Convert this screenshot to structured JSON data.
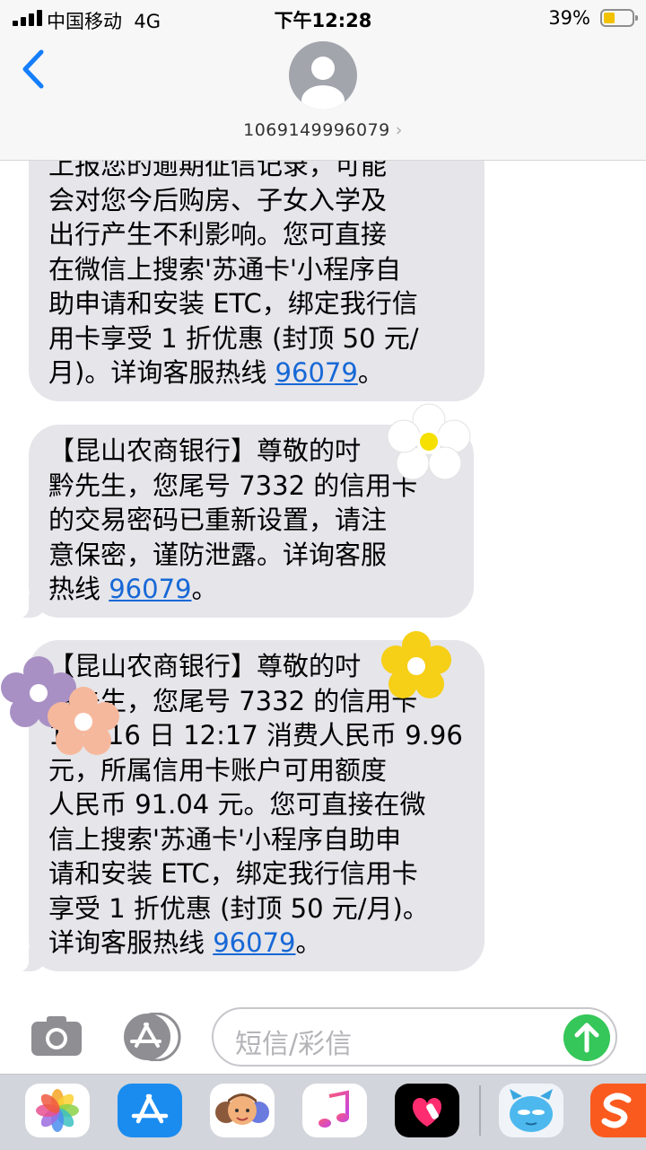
{
  "status_bar": {
    "carrier": "中国移动",
    "network": "4G",
    "time": "下午12:28",
    "battery_percent": "39%",
    "battery_level": 0.39
  },
  "header": {
    "contact_number": "1069149996079"
  },
  "messages": [
    {
      "text": "上报您的逾期征信记录，可能\n会对您今后购房、子女入学及\n出行产生不利影响。您可直接\n在微信上搜索'苏通卡'小程序自\n助申请和安装 ETC，绑定我行信\n用卡享受 1 折优惠 (封顶 50 元/\n月)。详询客服热线 ",
      "link": "96079",
      "suffix": "。"
    },
    {
      "text": "【昆山农商银行】尊敬的吋\n黔先生，您尾号 7332 的信用卡\n的交易密码已重新设置，请注\n意保密，谨防泄露。详询客服\n热线 ",
      "link": "96079",
      "suffix": "。"
    },
    {
      "text": "【昆山农商银行】尊敬的吋\n黔先生，您尾号 7332 的信用卡\n1 月 16 日 12:17 消费人民币 9.96\n元，所属信用卡账户可用额度\n人民币 91.04 元。您可直接在微\n信上搜索'苏通卡'小程序自助申\n请和安装 ETC，绑定我行信用卡\n享受 1 折优惠 (封顶 50 元/月)。\n详询客服热线 ",
      "link": "96079",
      "suffix": "。"
    }
  ],
  "input": {
    "placeholder": "短信/彩信"
  },
  "icons": {
    "back": "chevron-left-icon",
    "camera": "camera-icon",
    "app_store": "app-store-icon",
    "send": "arrow-up-icon"
  },
  "colors": {
    "link": "#1768d6",
    "bubble": "#e5e5ea",
    "send_button": "#35c759",
    "ios_blue": "#147efb"
  },
  "app_drawer": [
    "photos-app-icon",
    "app-store-app-icon",
    "memoji-app-icon",
    "music-app-icon",
    "digital-touch-app-icon",
    "sticker-app-icon",
    "sogou-app-icon"
  ]
}
